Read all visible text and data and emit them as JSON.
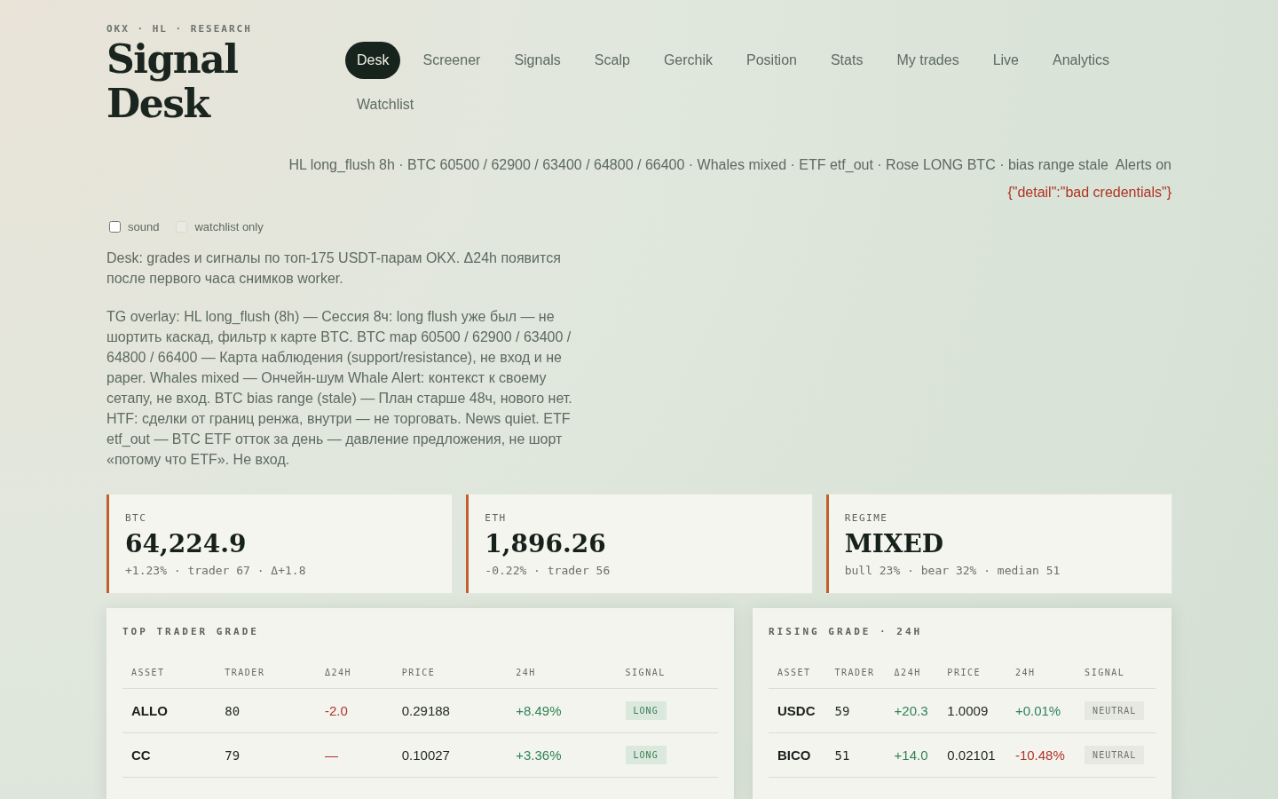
{
  "brand": {
    "kicker": "OKX · HL · RESEARCH",
    "title_lines": [
      "Signal",
      "Desk"
    ]
  },
  "nav": [
    {
      "label": "Desk",
      "selected": true
    },
    {
      "label": "Screener",
      "selected": false
    },
    {
      "label": "Signals",
      "selected": false
    },
    {
      "label": "Scalp",
      "selected": false
    },
    {
      "label": "Gerchik",
      "selected": false
    },
    {
      "label": "Position",
      "selected": false
    },
    {
      "label": "Stats",
      "selected": false
    },
    {
      "label": "My trades",
      "selected": false
    },
    {
      "label": "Live",
      "selected": false
    },
    {
      "label": "Analytics",
      "selected": false
    },
    {
      "label": "Watchlist",
      "selected": false
    }
  ],
  "status": {
    "summary": "HL long_flush 8h · BTC 60500 / 62900 / 63400 / 64800 / 66400 · Whales mixed · ETF etf_out · Rose LONG BTC · bias range stale",
    "alerts": "Alerts on",
    "error": "{\"detail\":\"bad credentials\"}"
  },
  "options": [
    {
      "label": "sound",
      "checked": false,
      "disabled": false
    },
    {
      "label": "watchlist only",
      "checked": false,
      "disabled": true
    }
  ],
  "notes": [
    "Desk: grades и сигналы по топ-175 USDT-парам OKX. Δ24h появится после первого часа снимков worker.",
    "TG overlay: HL long_flush (8h) — Сессия 8ч: long flush уже был — не шортить каскад, фильтр к карте BTC. BTC map 60500 / 62900 / 63400 / 64800 / 66400 — Карта наблюдения (support/resistance), не вход и не paper. Whales mixed — Ончейн-шум Whale Alert: контекст к своему сетапу, не вход. BTC bias range (stale) — План старше 48ч, нового нет. HTF: сделки от границ ренжа, внутри — не торговать. News quiet. ETF etf_out — BTC ETF отток за день — давление предложения, не шорт «потому что ETF». Не вход."
  ],
  "stats": [
    {
      "label": "BTC",
      "value": "64,224.9",
      "detail": "+1.23% · trader 67 · Δ+1.8"
    },
    {
      "label": "ETH",
      "value": "1,896.26",
      "detail": "-0.22% · trader 56"
    },
    {
      "label": "REGIME",
      "value": "MIXED",
      "detail": "bull 23% · bear 32% · median 51"
    }
  ],
  "tables": [
    {
      "title": "TOP TRADER GRADE",
      "columns": [
        "ASSET",
        "TRADER",
        "Δ24H",
        "PRICE",
        "24H",
        "SIGNAL"
      ],
      "rows": [
        {
          "asset": "ALLO",
          "trader": "80",
          "delta": {
            "text": "-2.0",
            "color": "#b3322a"
          },
          "price": "0.29188",
          "change": {
            "text": "+8.49%",
            "color": "#2f8457"
          },
          "signal": {
            "text": "LONG",
            "kind": "long"
          }
        },
        {
          "asset": "CC",
          "trader": "79",
          "delta": {
            "text": "—",
            "color": "#b3322a"
          },
          "price": "0.10027",
          "change": {
            "text": "+3.36%",
            "color": "#2f8457"
          },
          "signal": {
            "text": "LONG",
            "kind": "long"
          }
        }
      ]
    },
    {
      "title": "RISING GRADE · 24H",
      "columns": [
        "ASSET",
        "TRADER",
        "Δ24H",
        "PRICE",
        "24H",
        "SIGNAL"
      ],
      "rows": [
        {
          "asset": "USDC",
          "trader": "59",
          "delta": {
            "text": "+20.3",
            "color": "#2f8457"
          },
          "price": "1.0009",
          "change": {
            "text": "+0.01%",
            "color": "#2f8457"
          },
          "signal": {
            "text": "NEUTRAL",
            "kind": "neutral"
          }
        },
        {
          "asset": "BICO",
          "trader": "51",
          "delta": {
            "text": "+14.0",
            "color": "#2f8457"
          },
          "price": "0.02101",
          "change": {
            "text": "-10.48%",
            "color": "#b3322a"
          },
          "signal": {
            "text": "NEUTRAL",
            "kind": "neutral"
          }
        }
      ]
    }
  ]
}
